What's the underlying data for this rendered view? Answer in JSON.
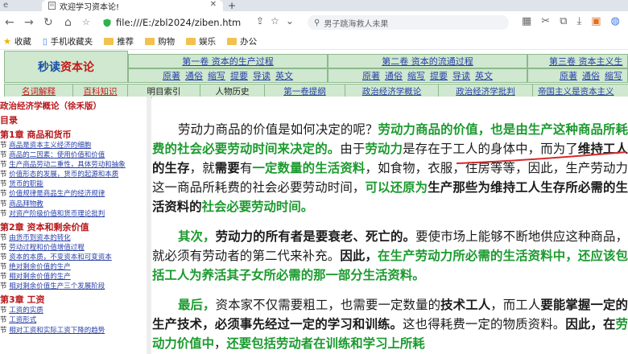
{
  "browser": {
    "prev_tab_label": "e",
    "tab_title": "欢迎学习资本论!",
    "url": "file:///E:/zbl2024/ziben.htm",
    "search_placeholder": "男子跳海救人未果",
    "bookmarks": [
      {
        "label": "收藏"
      },
      {
        "label": "手机收藏夹"
      },
      {
        "label": "推荐"
      },
      {
        "label": "购物"
      },
      {
        "label": "娱乐"
      },
      {
        "label": "办公"
      }
    ]
  },
  "header": {
    "logo_part1": "秒读",
    "logo_part2": "资本论",
    "volumes": [
      {
        "title": "第一卷 资本的生产过程",
        "links": [
          "原著",
          "通俗",
          "缩写",
          "提要",
          "导读",
          "英文"
        ]
      },
      {
        "title": "第二卷 资本的流通过程",
        "links": [
          "原著",
          "通俗",
          "缩写",
          "提要",
          "导读",
          "英文"
        ]
      },
      {
        "title": "第三卷 资本主义生",
        "links": [
          "原著",
          "通俗",
          "缩写"
        ]
      }
    ],
    "row3": [
      "名词解释",
      "百科知识",
      "明目索引",
      "人物历史",
      "第一卷提纲",
      "政治经济学概论",
      "政治经济学批判",
      "帝国主义是资本主义"
    ]
  },
  "sidebar": {
    "title": "政治经济学概论（徐禾版）",
    "toc_label": "目录",
    "chapter1": "第1章 商品和货币",
    "chapter1_items": [
      "商品是资本主义经济的细胞",
      "商品的二因素：使用价值和价值",
      "生产商品劳动二重性，具体劳动和抽象",
      "价值形态的发展，货币的起源和本质",
      "货币的职能",
      "价值规律是商品生产的经济规律",
      "商品拜物教",
      "对资产阶级价值和货币理论批判"
    ],
    "chapter2": "第2章 资本和剩余价值",
    "chapter2_items": [
      "由货币到资本的转化",
      "劳动过程和价值增值过程",
      "资本的本质，不变资本和可变资本",
      "绝对剩余价值的生产",
      "相对剩余价值的生产",
      "相对剩余价值生产三个发展阶段"
    ],
    "chapter3": "第3章 工资",
    "chapter3_items": [
      "工资的实质",
      "工资形式",
      "相对工资和实际工资下降的趋势"
    ],
    "item_prefix": "节"
  },
  "content": {
    "p1": [
      {
        "t": "劳动力商品的价值是如何决定的呢？",
        "s": ""
      },
      {
        "t": "劳动力商品的价值，也是由生产这种商品所耗费的社会必要劳动时间来决定的。",
        "s": "g"
      },
      {
        "t": "由于",
        "s": ""
      },
      {
        "t": "劳动力",
        "s": "g"
      },
      {
        "t": "是存在于工人的身体中，而为了",
        "s": ""
      },
      {
        "t": "维持工人的生存",
        "s": "b"
      },
      {
        "t": "，就",
        "s": ""
      },
      {
        "t": "需要",
        "s": "b"
      },
      {
        "t": "有",
        "s": ""
      },
      {
        "t": "一定数量的生活资料",
        "s": "g"
      },
      {
        "t": "，如食物，衣服，住房等等，因此，生产劳动力这一商品所耗费的社会必要劳动时间，",
        "s": ""
      },
      {
        "t": "可以还原为",
        "s": "g"
      },
      {
        "t": "生产那些为维持工人生存所必需的生活资料的",
        "s": "b"
      },
      {
        "t": "社会必要劳动时间。",
        "s": "g"
      }
    ],
    "p2": [
      {
        "t": "其次，",
        "s": "g"
      },
      {
        "t": "劳动力的所有者是要衰老、死亡的。",
        "s": "b"
      },
      {
        "t": "要使市场上能够不断地供应这种商品，就必须有劳动者的第二代来补充。",
        "s": ""
      },
      {
        "t": "因此，",
        "s": "b"
      },
      {
        "t": "在生产劳动力所必需的生活资料中，还应该包括工人为养活其子女所必需的那一部分生活资料。",
        "s": "g"
      }
    ],
    "p3": [
      {
        "t": "最后，",
        "s": "g"
      },
      {
        "t": "资本家不仅需要粗工，也需要一定数量的",
        "s": ""
      },
      {
        "t": "技术工人",
        "s": "b"
      },
      {
        "t": "，而工人",
        "s": ""
      },
      {
        "t": "要能掌握一定的生产技术，必须事先经过一定的学习和训练。",
        "s": "b"
      },
      {
        "t": "这也得耗费一定的物质资料。",
        "s": ""
      },
      {
        "t": "因此，在",
        "s": "b"
      },
      {
        "t": "劳动力价值中",
        "s": "g"
      },
      {
        "t": "，",
        "s": ""
      },
      {
        "t": "还要包括劳动者在训练和学习上所耗",
        "s": "g"
      }
    ]
  }
}
